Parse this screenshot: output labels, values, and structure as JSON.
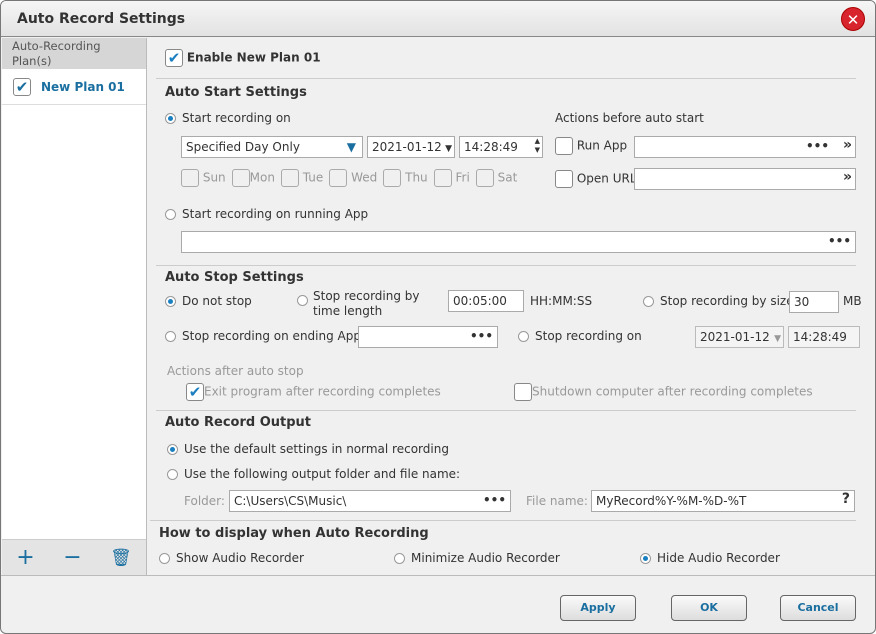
{
  "window": {
    "title": "Auto Record Settings"
  },
  "sidebar": {
    "header": "Auto-Recording Plan(s)",
    "plans": [
      {
        "label": "New Plan 01",
        "checked": true
      }
    ],
    "add": "+",
    "remove": "−",
    "delete": "🗑"
  },
  "main": {
    "enable_label": "Enable New Plan 01",
    "start": {
      "title": "Auto Start Settings",
      "opt_on": "Start recording on",
      "mode": "Specified Day Only",
      "date": "2021-01-12",
      "time": "14:28:49",
      "days": [
        "Sun",
        "Mon",
        "Tue",
        "Wed",
        "Thu",
        "Fri",
        "Sat"
      ],
      "opt_app": "Start recording on running App",
      "actions_title": "Actions before auto start",
      "run_app": "Run App",
      "open_url": "Open URL"
    },
    "stop": {
      "title": "Auto Stop Settings",
      "do_not_stop": "Do not stop",
      "by_time": "Stop recording by time length",
      "time_value": "00:05:00",
      "time_unit": "HH:MM:SS",
      "by_size": "Stop recording by size",
      "size_value": "30",
      "size_unit": "MB",
      "on_ending_app": "Stop recording on ending App",
      "on_date": "Stop recording on",
      "date": "2021-01-12",
      "time": "14:28:49",
      "actions_title": "Actions after auto stop",
      "exit_program": "Exit program after recording completes",
      "shutdown": "Shutdown computer after recording completes"
    },
    "output": {
      "title": "Auto Record Output",
      "default": "Use the default settings in normal recording",
      "custom": "Use the following output folder and file name:",
      "folder_label": "Folder:",
      "folder": "C:\\Users\\CS\\Music\\",
      "file_label": "File name:",
      "file": "MyRecord%Y-%M-%D-%T"
    },
    "display": {
      "title": "How to display when Auto Recording",
      "show": "Show Audio Recorder",
      "minimize": "Minimize Audio Recorder",
      "hide": "Hide Audio Recorder"
    }
  },
  "footer": {
    "apply": "Apply",
    "ok": "OK",
    "cancel": "Cancel"
  },
  "colors": {
    "accent": "#1a7fc0",
    "close": "#d8242c"
  }
}
